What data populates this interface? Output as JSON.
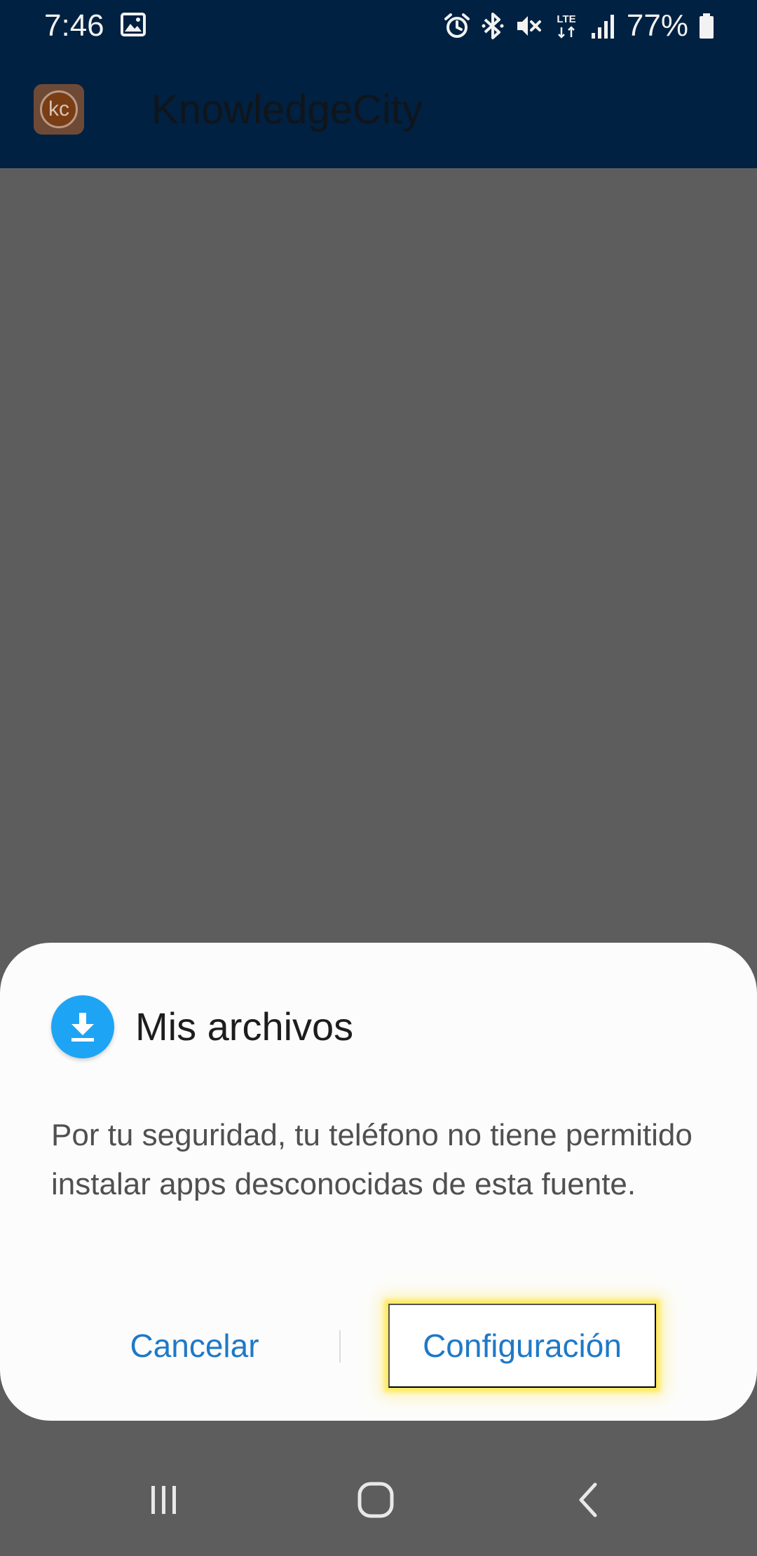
{
  "status_bar": {
    "time": "7:46",
    "battery_percent": "77%",
    "network_type": "LTE",
    "icons": [
      "image-icon",
      "alarm-icon",
      "bluetooth-icon",
      "mute-icon",
      "lte-icon",
      "signal-icon",
      "battery-icon"
    ]
  },
  "app_bar": {
    "logo_text": "kc",
    "title": "KnowledgeCity"
  },
  "dialog": {
    "icon": "download-icon",
    "icon_color": "#1ea4f4",
    "title": "Mis archivos",
    "message": "Por tu seguridad, tu teléfono no tiene permitido instalar apps desconocidas de esta fuente.",
    "cancel_label": "Cancelar",
    "confirm_label": "Configuración",
    "highlight_color": "#ffe95a"
  },
  "nav_bar": {
    "buttons": [
      "recent-apps-icon",
      "home-icon",
      "back-icon"
    ]
  },
  "colors": {
    "header_bg": "#002141",
    "overlay_bg": "#5d5d5d",
    "accent": "#1f79c7"
  }
}
